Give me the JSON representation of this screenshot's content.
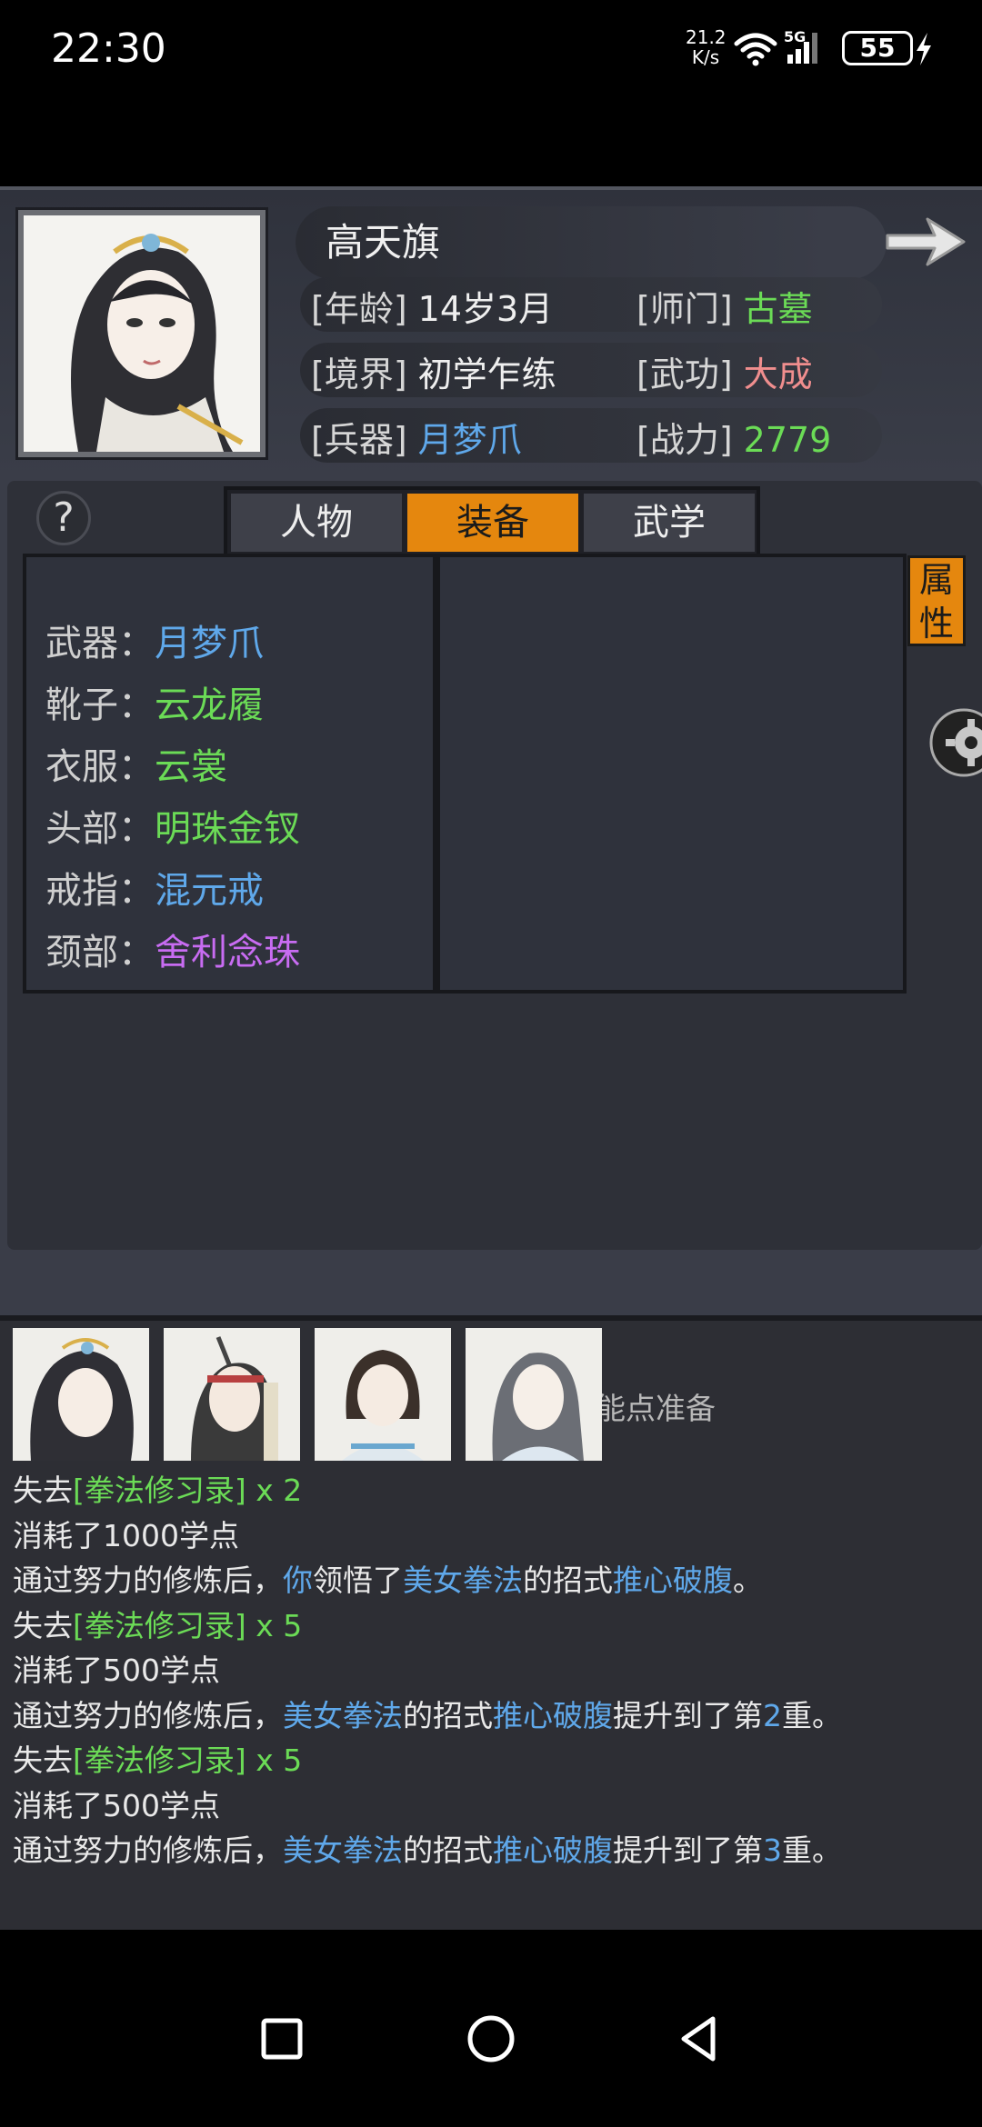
{
  "status_bar": {
    "time": "22:30",
    "net_speed_value": "21.2",
    "net_speed_unit": "K/s",
    "signal_type": "5G",
    "battery": "55",
    "icons": [
      "wifi-icon",
      "signal-icon",
      "battery-icon",
      "charging-icon"
    ]
  },
  "character": {
    "name": "高天旗",
    "age_label": "[年龄]",
    "age": "14岁3月",
    "realm_label": "[境界]",
    "realm": "初学乍练",
    "weapon_label": "[兵器]",
    "weapon": "月梦爪",
    "school_label": "[师门]",
    "school": "古墓",
    "martial_label": "[武功]",
    "martial": "大成",
    "power_label": "[战力]",
    "power": "2779"
  },
  "tabs": [
    {
      "label": "人物",
      "active": false
    },
    {
      "label": "装备",
      "active": true
    },
    {
      "label": "武学",
      "active": false
    }
  ],
  "help_label": "?",
  "side_tab": {
    "line1": "属",
    "line2": "性"
  },
  "equipment": [
    {
      "label": "武器：",
      "value": "月梦爪",
      "color": "#5fa8ea"
    },
    {
      "label": "靴子：",
      "value": "云龙履",
      "color": "#6bdb56"
    },
    {
      "label": "衣服：",
      "value": "云裳",
      "color": "#6bdb56"
    },
    {
      "label": "头部：",
      "value": "明珠金钗",
      "color": "#6bdb56"
    },
    {
      "label": "戒指：",
      "value": "混元戒",
      "color": "#5fa8ea"
    },
    {
      "label": "颈部：",
      "value": "舍利念珠",
      "color": "#c86cf2"
    }
  ],
  "log": {
    "partial_text": "能点准备",
    "lines": [
      [
        {
          "t": "失去"
        },
        {
          "t": "[拳法修习录] x 2",
          "c": "g"
        }
      ],
      [
        {
          "t": "消耗了1000学点"
        }
      ],
      [
        {
          "t": "通过努力的修炼后，"
        },
        {
          "t": "你",
          "c": "b"
        },
        {
          "t": "领悟了"
        },
        {
          "t": "美女拳法",
          "c": "b"
        },
        {
          "t": "的招式"
        },
        {
          "t": "推心破腹",
          "c": "b"
        },
        {
          "t": "。"
        }
      ],
      [
        {
          "t": "失去"
        },
        {
          "t": "[拳法修习录] x 5",
          "c": "g"
        }
      ],
      [
        {
          "t": "消耗了500学点"
        }
      ],
      [
        {
          "t": "通过努力的修炼后，"
        },
        {
          "t": "美女拳法",
          "c": "b"
        },
        {
          "t": "的招式"
        },
        {
          "t": "推心破腹",
          "c": "b"
        },
        {
          "t": "提升到了第"
        },
        {
          "t": "2",
          "c": "b"
        },
        {
          "t": "重。"
        }
      ],
      [
        {
          "t": "失去"
        },
        {
          "t": "[拳法修习录] x 5",
          "c": "g"
        }
      ],
      [
        {
          "t": "消耗了500学点"
        }
      ],
      [
        {
          "t": "通过努力的修炼后，"
        },
        {
          "t": "美女拳法",
          "c": "b"
        },
        {
          "t": "的招式"
        },
        {
          "t": "推心破腹",
          "c": "b"
        },
        {
          "t": "提升到了第"
        },
        {
          "t": "3",
          "c": "b"
        },
        {
          "t": "重。"
        }
      ]
    ]
  },
  "nav": [
    "recent-apps-button",
    "home-button",
    "back-button"
  ]
}
